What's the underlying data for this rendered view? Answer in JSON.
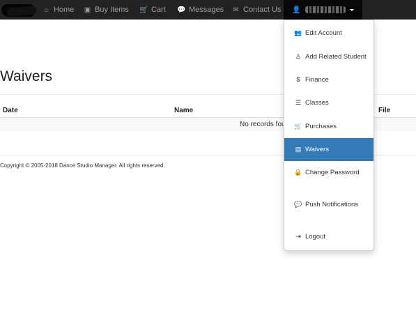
{
  "navbar": {
    "items": [
      {
        "label": "Home",
        "icon": "home-icon",
        "glyph": "⌂"
      },
      {
        "label": "Buy Items",
        "icon": "package-icon",
        "glyph": "▣"
      },
      {
        "label": "Cart",
        "icon": "cart-icon",
        "glyph": "🛒"
      },
      {
        "label": "Messages",
        "icon": "comments-icon",
        "glyph": "💬"
      },
      {
        "label": "Contact Us",
        "icon": "envelope-icon",
        "glyph": "✉"
      }
    ],
    "user": {
      "icon": "user-icon",
      "glyph": "👤"
    }
  },
  "page": {
    "title": "Waivers"
  },
  "table": {
    "columns": [
      "Date",
      "Name",
      "File"
    ],
    "empty_message": "No records found"
  },
  "footer": {
    "copyright": "Copyright © 2005-2018 Dance Studio Manager. All rights reserved."
  },
  "dropdown": {
    "items": [
      {
        "label": "Edit Account",
        "icon": "users-icon",
        "glyph": "👥",
        "active": false
      },
      {
        "label": "Add Related Student",
        "icon": "student-icon",
        "glyph": "♙",
        "active": false
      },
      {
        "label": "Finance",
        "icon": "dollar-icon",
        "glyph": "$",
        "active": false
      },
      {
        "label": "Classes",
        "icon": "list-icon",
        "glyph": "☰",
        "active": false
      },
      {
        "label": "Purchases",
        "icon": "cart-icon",
        "glyph": "🛒",
        "active": false
      },
      {
        "label": "Waivers",
        "icon": "file-icon",
        "glyph": "▤",
        "active": true
      },
      {
        "label": "Change Password",
        "icon": "lock-icon",
        "glyph": "🔒",
        "active": false
      },
      {
        "label": "Push Notifications",
        "icon": "comments-icon",
        "glyph": "💬",
        "active": false
      },
      {
        "label": "Logout",
        "icon": "logout-icon",
        "glyph": "⇥",
        "active": false
      }
    ]
  },
  "colors": {
    "navbar_bg": "#222222",
    "active_bg": "#337ab7"
  }
}
